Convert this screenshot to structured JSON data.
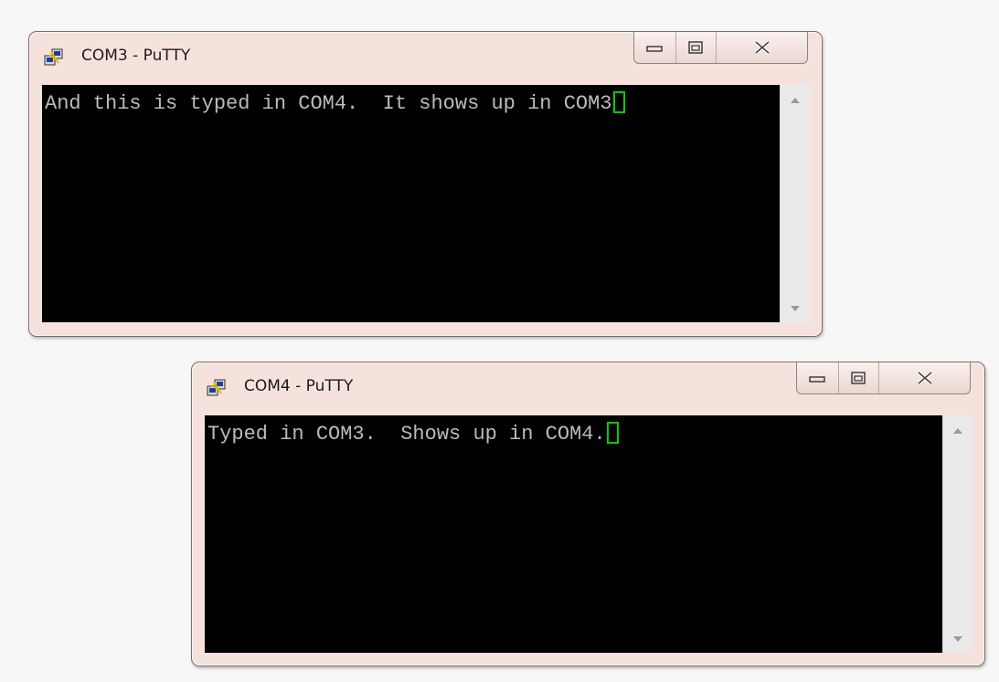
{
  "windows": [
    {
      "title": "COM3 - PuTTY",
      "terminal_text": "And this is typed in COM4.  It shows up in COM3",
      "icons": {
        "app": "putty-icon",
        "minimize": "minimize-icon",
        "maximize": "maximize-icon",
        "close": "close-icon"
      }
    },
    {
      "title": "COM4 - PuTTY",
      "terminal_text": "Typed in COM3.  Shows up in COM4.",
      "icons": {
        "app": "putty-icon",
        "minimize": "minimize-icon",
        "maximize": "maximize-icon",
        "close": "close-icon"
      }
    }
  ],
  "colors": {
    "window_frame": "#f6e2dc",
    "terminal_bg": "#000000",
    "terminal_text": "#bbbbbb",
    "cursor": "#00d000"
  }
}
